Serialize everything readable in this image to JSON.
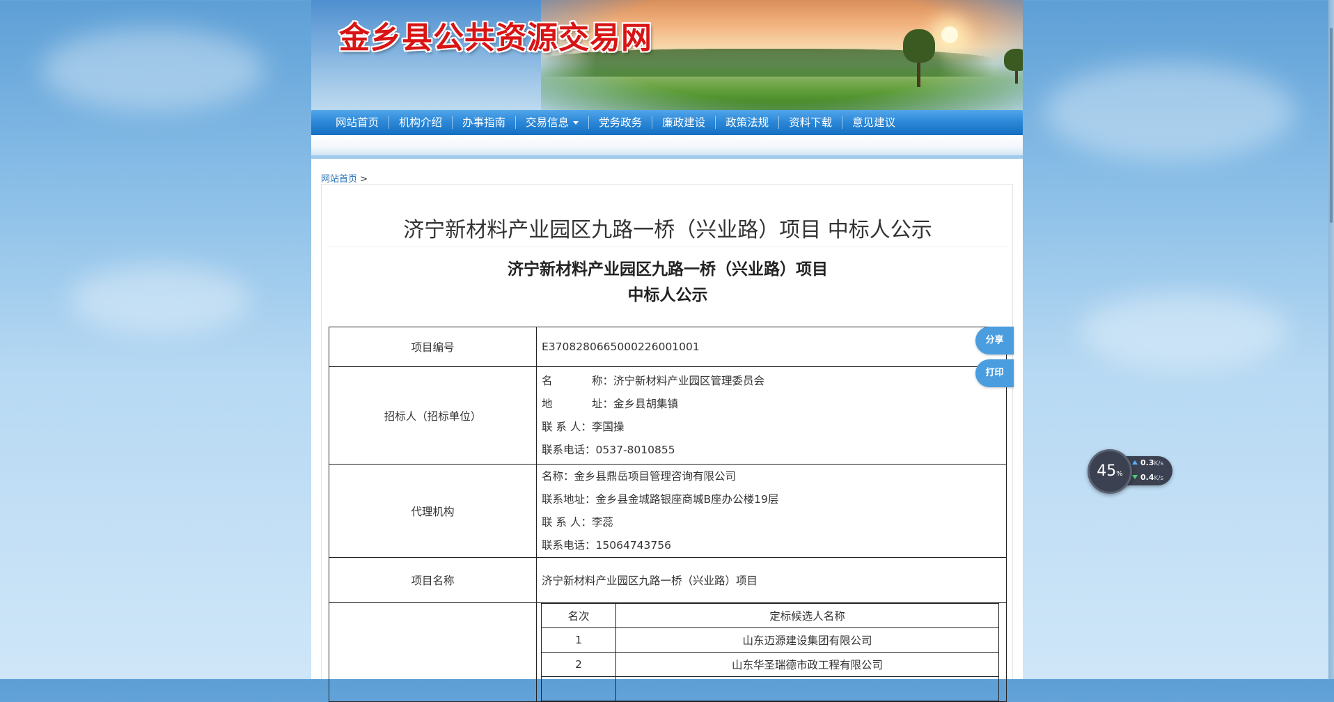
{
  "site": {
    "title": "金乡县公共资源交易网"
  },
  "nav": {
    "items": [
      "网站首页",
      "机构介绍",
      "办事指南",
      "交易信息",
      "党务政务",
      "廉政建设",
      "政策法规",
      "资料下载",
      "意见建议"
    ]
  },
  "breadcrumb": {
    "home": "网站首页",
    "sep": ">"
  },
  "article": {
    "title": "济宁新材料产业园区九路一桥（兴业路）项目 中标人公示",
    "heading_line1": "济宁新材料产业园区九路一桥（兴业路）项目",
    "heading_line2": "中标人公示"
  },
  "table": {
    "project_code_label": "项目编号",
    "project_code": "E3708280665000226001001",
    "tenderer_label": "招标人（招标单位）",
    "tenderer": {
      "name_k1": "名",
      "name_k2": "称：",
      "name": "济宁新材料产业园区管理委员会",
      "addr_k1": "地",
      "addr_k2": "址：",
      "addr": "金乡县胡集镇",
      "contact_k": "联 系 人：",
      "contact": "李国操",
      "phone_k": "联系电话：",
      "phone": "0537-8010855"
    },
    "agency_label": "代理机构",
    "agency": {
      "name_k": "名称：",
      "name": "金乡县鼎岳项目管理咨询有限公司",
      "addr_k": "联系地址：",
      "addr": "金乡县金城路银座商城B座办公楼19层",
      "contact_k": "联 系 人：",
      "contact": "李蕊",
      "phone_k": "联系电话：",
      "phone": "15064743756"
    },
    "project_name_label": "项目名称",
    "project_name": "济宁新材料产业园区九路一桥（兴业路）项目",
    "candidates_header": {
      "rank": "名次",
      "name": "定标候选人名称"
    },
    "candidates": [
      {
        "rank": "1",
        "name": "山东迈源建设集团有限公司"
      },
      {
        "rank": "2",
        "name": "山东华圣瑞德市政工程有限公司"
      }
    ]
  },
  "side_buttons": {
    "share": "分享",
    "print": "打印"
  },
  "widget": {
    "percent": "45",
    "percent_unit": "%",
    "up": "0.3",
    "down": "0.4",
    "unit": "K/s"
  },
  "colors": {
    "title_red": "#d91414",
    "nav_blue": "#2a86d6",
    "side_btn": "#4a9ee0"
  }
}
